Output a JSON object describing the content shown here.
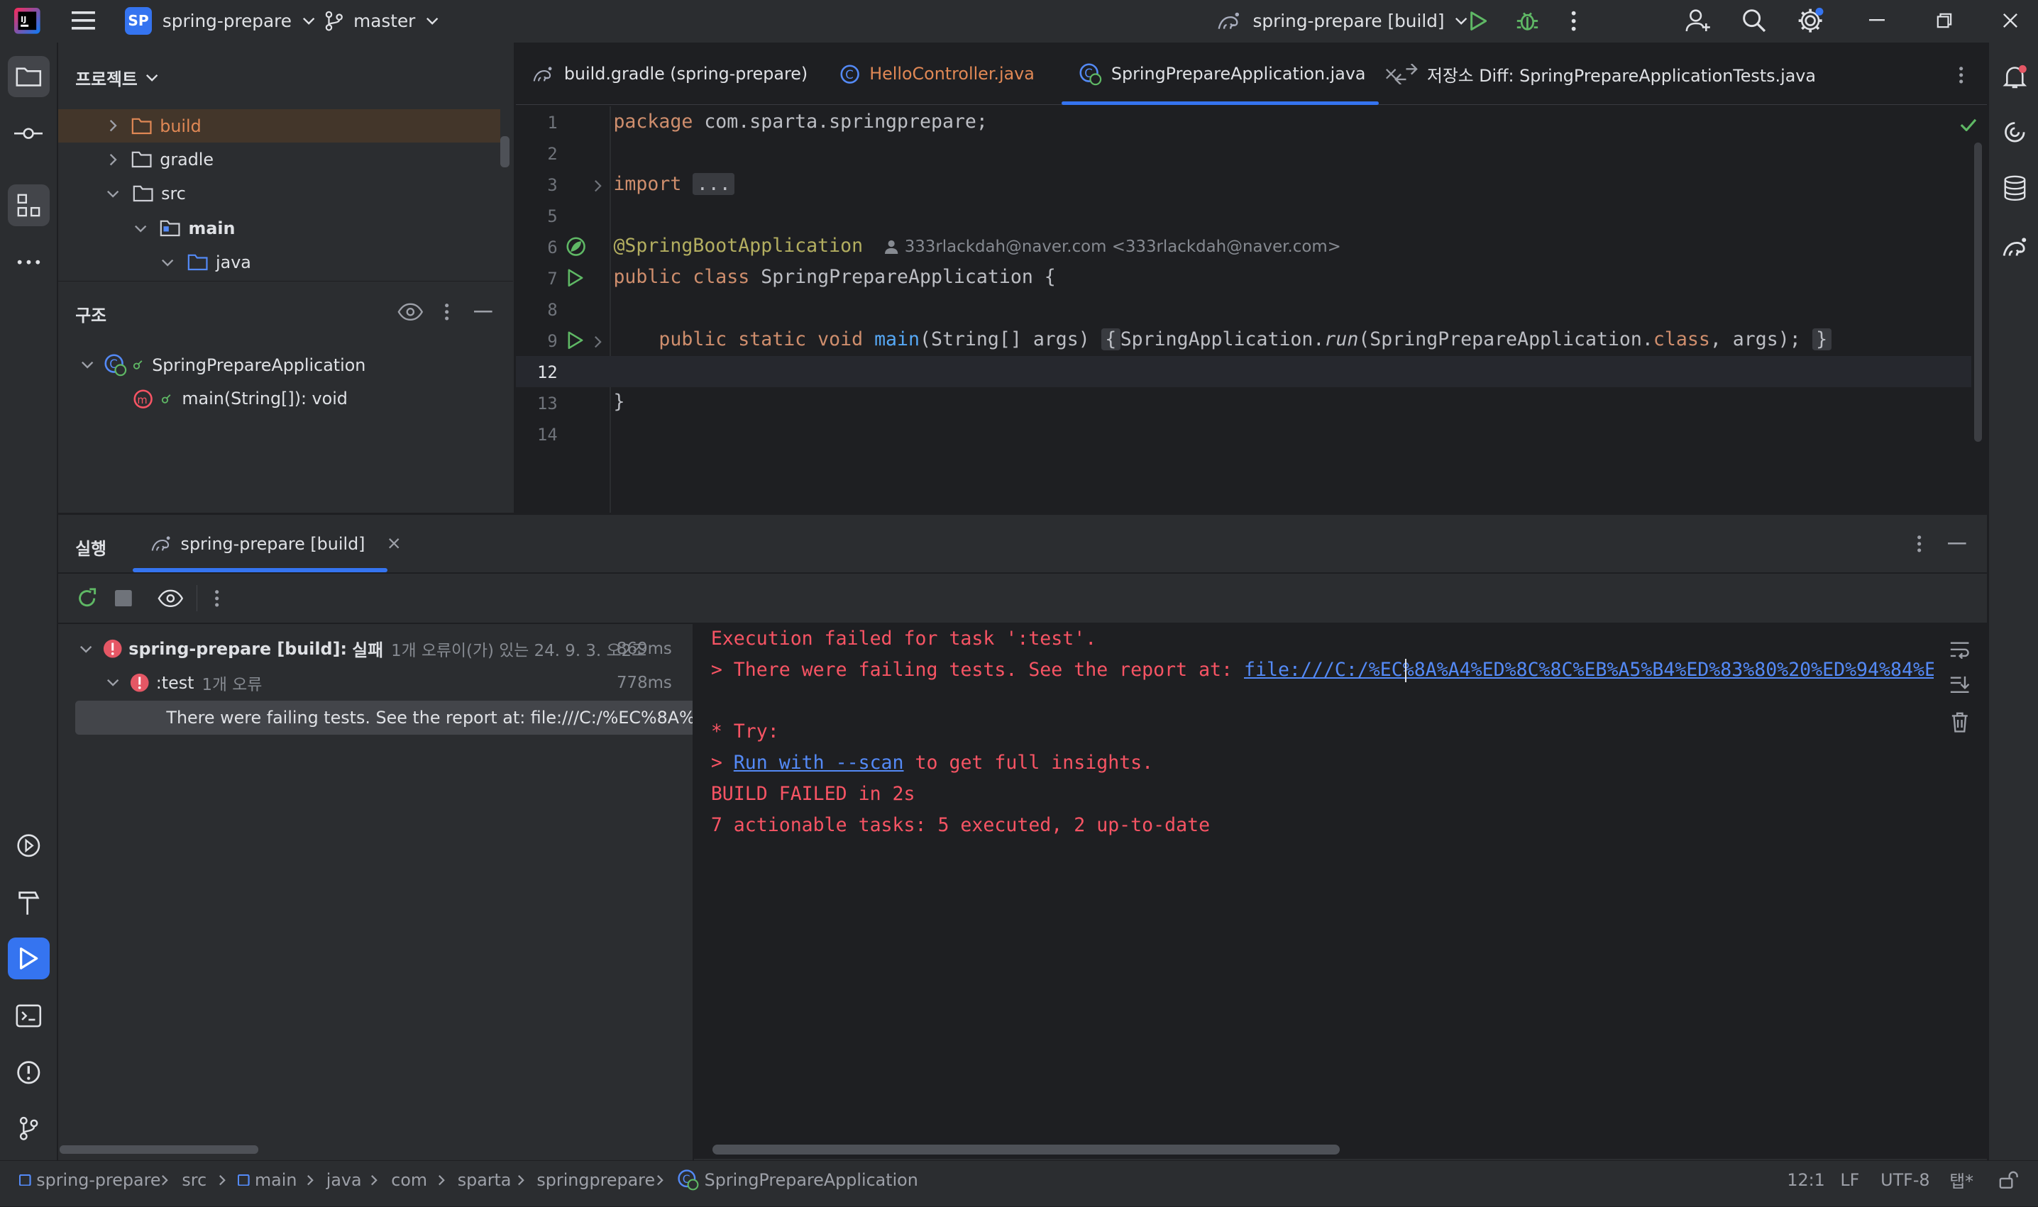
{
  "titlebar": {
    "project_badge": "SP",
    "project_name": "spring-prepare",
    "branch": "master",
    "run_config": "spring-prepare [build]"
  },
  "project_panel": {
    "title": "프로젝트",
    "tree": [
      "build",
      "gradle",
      "src",
      "main",
      "java"
    ]
  },
  "structure_panel": {
    "title": "구조",
    "class_name": "SpringPrepareApplication",
    "method": "main(String[]): void"
  },
  "editor": {
    "tabs": [
      {
        "label": "build.gradle (spring-prepare)"
      },
      {
        "label": "HelloController.java"
      },
      {
        "label": "SpringPrepareApplication.java"
      },
      {
        "label": "저장소 Diff: SpringPrepareApplicationTests.java"
      }
    ],
    "line_numbers": [
      "1",
      "2",
      "3",
      "5",
      "6",
      "7",
      "8",
      "9",
      "12",
      "13",
      "14"
    ],
    "code": {
      "line1_kw": "package",
      "line1_rest": " com.sparta.springprepare;",
      "line3_kw": "import",
      "line3_fold": "...",
      "line6_ann": "@SpringBootApplication",
      "author_hint": "333rlackdah@naver.com <333rlackdah@naver.com>",
      "line7_kw": "public class",
      "line7_rest": " SpringPrepareApplication {",
      "line9_kw": "public static void",
      "line9_fn": "main",
      "line9_args": "(String[] args)",
      "line9_open": "{",
      "line9_call1": "SpringApplication.",
      "line9_run": "run",
      "line9_call2": "(SpringPrepareApplication.",
      "line9_class_kw": "class",
      "line9_call3": ", args);",
      "line9_close": "}",
      "line13": "}"
    }
  },
  "run_panel": {
    "title": "실행",
    "tab_label": "spring-prepare [build]",
    "tree": {
      "root_label": "spring-prepare [build]:",
      "root_status": "실패",
      "root_detail": "1개 오류이(가) 있는 24. 9. 3. 오2조",
      "root_time": "869ms",
      "test_label": ":test",
      "test_detail": "1개 오류",
      "test_time": "778ms",
      "error_label": "There were failing tests. See the report at: file:///C:/%EC%8A%A4%"
    },
    "console": {
      "line1": "Execution failed for task ':test'.",
      "line2_prefix": "> There were failing tests. See the report at: ",
      "line2_link": "file:///C:/%EC%8A%A4%ED%8C%8C%EB%A5%B4%ED%83%80%20%ED%94%84%E",
      "line4": "* Try:",
      "line5_prefix": "> ",
      "line5_link": "Run with --scan",
      "line5_suffix": " to get full insights.",
      "line6": "BUILD FAILED in 2s",
      "line7": "7 actionable tasks: 5 executed, 2 up-to-date"
    }
  },
  "statusbar": {
    "breadcrumbs": [
      "spring-prepare",
      "src",
      "main",
      "java",
      "com",
      "sparta",
      "springprepare",
      "SpringPrepareApplication"
    ],
    "position": "12:1",
    "line_sep": "LF",
    "encoding": "UTF-8",
    "indent": "탭*"
  },
  "colors": {
    "accent": "#3574f0",
    "error": "#f75464",
    "keyword": "#cf8e6d",
    "annotation": "#b3ae60",
    "function": "#56a8f5",
    "link": "#548af7"
  }
}
